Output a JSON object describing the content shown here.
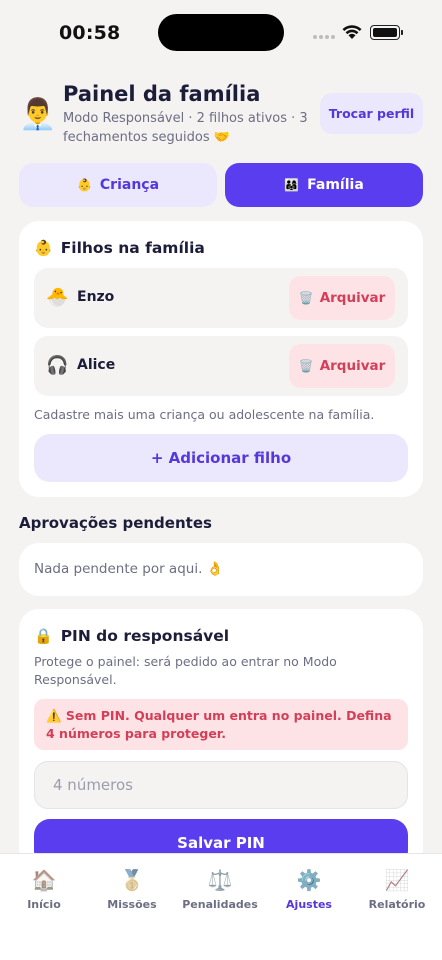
{
  "status_bar": {
    "time": "00:58"
  },
  "header": {
    "avatar_emoji": "👨‍💼",
    "title": "Painel da família",
    "subtitle": "Modo Responsável · 2 filhos ativos · 3 fechamentos seguidos 🤝",
    "switch_profile_label": "Trocar perfil"
  },
  "mode_toggle": {
    "crianca": {
      "icon": "👶",
      "label": "Criança"
    },
    "familia": {
      "icon": "👨‍👩‍👧",
      "label": "Família"
    },
    "selected": "Família"
  },
  "kids_card": {
    "icon": "👶",
    "title": "Filhos na família",
    "children": [
      {
        "icon": "🐣",
        "name": "Enzo",
        "archive_icon": "🗑️",
        "archive_label": "Arquivar"
      },
      {
        "icon": "🎧",
        "name": "Alice",
        "archive_icon": "🗑️",
        "archive_label": "Arquivar"
      }
    ],
    "hint": "Cadastre mais uma criança ou adolescente na família.",
    "add_button_label": "+ Adicionar filho"
  },
  "pending": {
    "section_title": "Aprovações pendentes",
    "empty_text": "Nada pendente por aqui. 👌"
  },
  "pin_card": {
    "icon": "🔒",
    "title": "PIN do responsável",
    "description": "Protege o painel: será pedido ao entrar no Modo Responsável.",
    "warning": "⚠️ Sem PIN. Qualquer um entra no painel. Defina 4 números para proteger.",
    "input_value": "",
    "input_placeholder": "4 números",
    "save_button_label": "Salvar PIN"
  },
  "tab_bar": {
    "items": [
      {
        "icon": "🏠",
        "label": "Início"
      },
      {
        "icon": "🥇",
        "label": "Missões"
      },
      {
        "icon": "⚖️",
        "label": "Penalidades"
      },
      {
        "icon": "⚙️",
        "label": "Ajustes"
      },
      {
        "icon": "📈",
        "label": "Relatório"
      }
    ],
    "active": "Ajustes"
  },
  "colors": {
    "accent": "#5b3df0",
    "accent_soft": "#ebe7fd",
    "danger": "#d33f58",
    "danger_soft": "#fde3e5",
    "background": "#f4f3f1"
  }
}
